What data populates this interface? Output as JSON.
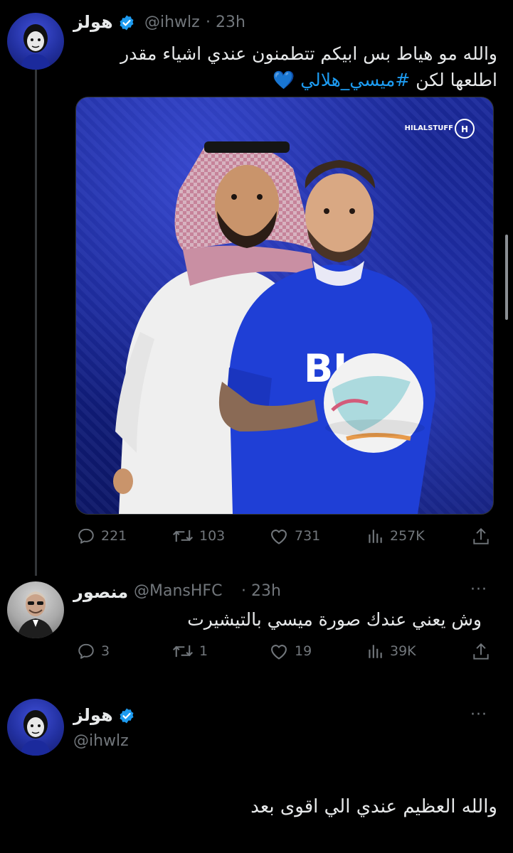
{
  "tweet1": {
    "name": "هولز",
    "handle": "@ihwlz",
    "time": "· 23h",
    "text_line1": "والله مو هياط بس ابيكم تتطمنون عندي اشياء مقدر",
    "text_line2_prefix": "اطلعها لكن ",
    "hashtag": "#ميسي_هلالي",
    "emoji": "💙",
    "image_watermark": "HILALSTUFF",
    "actions": {
      "replies": "221",
      "retweets": "103",
      "likes": "731",
      "views": "257K"
    }
  },
  "reply": {
    "name": "منصور",
    "handle": "@MansHFC",
    "time": "· 23h",
    "more": "···",
    "text": "وش يعني عندك صورة ميسي بالتيشيرت",
    "actions": {
      "replies": "3",
      "retweets": "1",
      "likes": "19",
      "views": "39K"
    }
  },
  "tweet2": {
    "name": "هولز",
    "handle": "@ihwlz",
    "more": "···",
    "text": "والله العظيم عندي الي اقوى بعد"
  },
  "colors": {
    "background": "#000000",
    "text": "#e7e9ea",
    "muted": "#71767b",
    "link": "#1d9bf0",
    "verified": "#1d9bf0",
    "heart_emoji": "#5aa7ff"
  },
  "icons": [
    "verified-badge-icon",
    "reply-icon",
    "retweet-icon",
    "like-icon",
    "views-icon",
    "share-icon",
    "more-icon"
  ]
}
